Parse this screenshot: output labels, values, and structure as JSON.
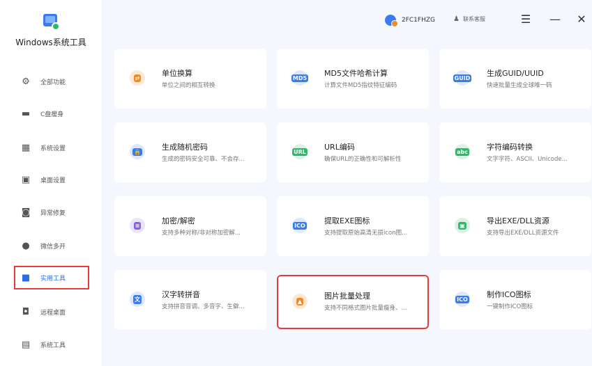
{
  "app": {
    "title": "Windows系统工具"
  },
  "sidebar": {
    "items": [
      {
        "label": "全部功能",
        "icon": "gear-icon"
      },
      {
        "label": "C盘瘦身",
        "icon": "drive-icon"
      },
      {
        "label": "系统设置",
        "icon": "grid-icon"
      },
      {
        "label": "桌面设置",
        "icon": "monitor-icon"
      },
      {
        "label": "异常修复",
        "icon": "repair-icon"
      },
      {
        "label": "微信多开",
        "icon": "chat-icon"
      },
      {
        "label": "实用工具",
        "icon": "toolbox-icon"
      },
      {
        "label": "远程桌面",
        "icon": "remote-icon"
      },
      {
        "label": "系统工具",
        "icon": "briefcase-icon"
      }
    ]
  },
  "header": {
    "user_name": "2FC1FHZG",
    "support_label": "联系客服",
    "menu_glyph": "☰",
    "minimize_glyph": "—",
    "close_glyph": "✕"
  },
  "tools": [
    {
      "title": "单位换算",
      "desc": "单位之间的相互转换",
      "glyph": "⇄",
      "color": "#f08a24"
    },
    {
      "title": "MD5文件哈希计算",
      "desc": "计算文件MD5指纹特征编码",
      "glyph": "MD5",
      "color": "#3a7bf0"
    },
    {
      "title": "生成GUID/UUID",
      "desc": "快速批量生成全球唯一码",
      "glyph": "GUID",
      "color": "#3a7bf0"
    },
    {
      "title": "生成随机密码",
      "desc": "生成的密码安全可靠、不会存...",
      "glyph": "🔒",
      "color": "#3a7bf0"
    },
    {
      "title": "URL编码",
      "desc": "确保URL的正确性和可解析性",
      "glyph": "URL",
      "color": "#2fb86a"
    },
    {
      "title": "字符编码转换",
      "desc": "文字字符、ASCII、Unicode...",
      "glyph": "abc",
      "color": "#2fb86a"
    },
    {
      "title": "加密/解密",
      "desc": "支持多种对称/非对称加密解...",
      "glyph": "≡",
      "color": "#8a5cf0"
    },
    {
      "title": "提取EXE图标",
      "desc": "支持提取原始高清无损icon图...",
      "glyph": "ICO",
      "color": "#3a7bf0"
    },
    {
      "title": "导出EXE/DLL资源",
      "desc": "支持导出EXE/DLL资源文件",
      "glyph": "▣",
      "color": "#2fb86a"
    },
    {
      "title": "汉字转拼音",
      "desc": "支持拼音音调、多音字、生僻...",
      "glyph": "文",
      "color": "#3a7bf0"
    },
    {
      "title": "图片批量处理",
      "desc": "支持不同格式图片批量瘦身、...",
      "glyph": "▲",
      "color": "#f08a24"
    },
    {
      "title": "制作ICO图标",
      "desc": "一键制作ICO图标",
      "glyph": "ICO",
      "color": "#3a7bf0"
    }
  ]
}
